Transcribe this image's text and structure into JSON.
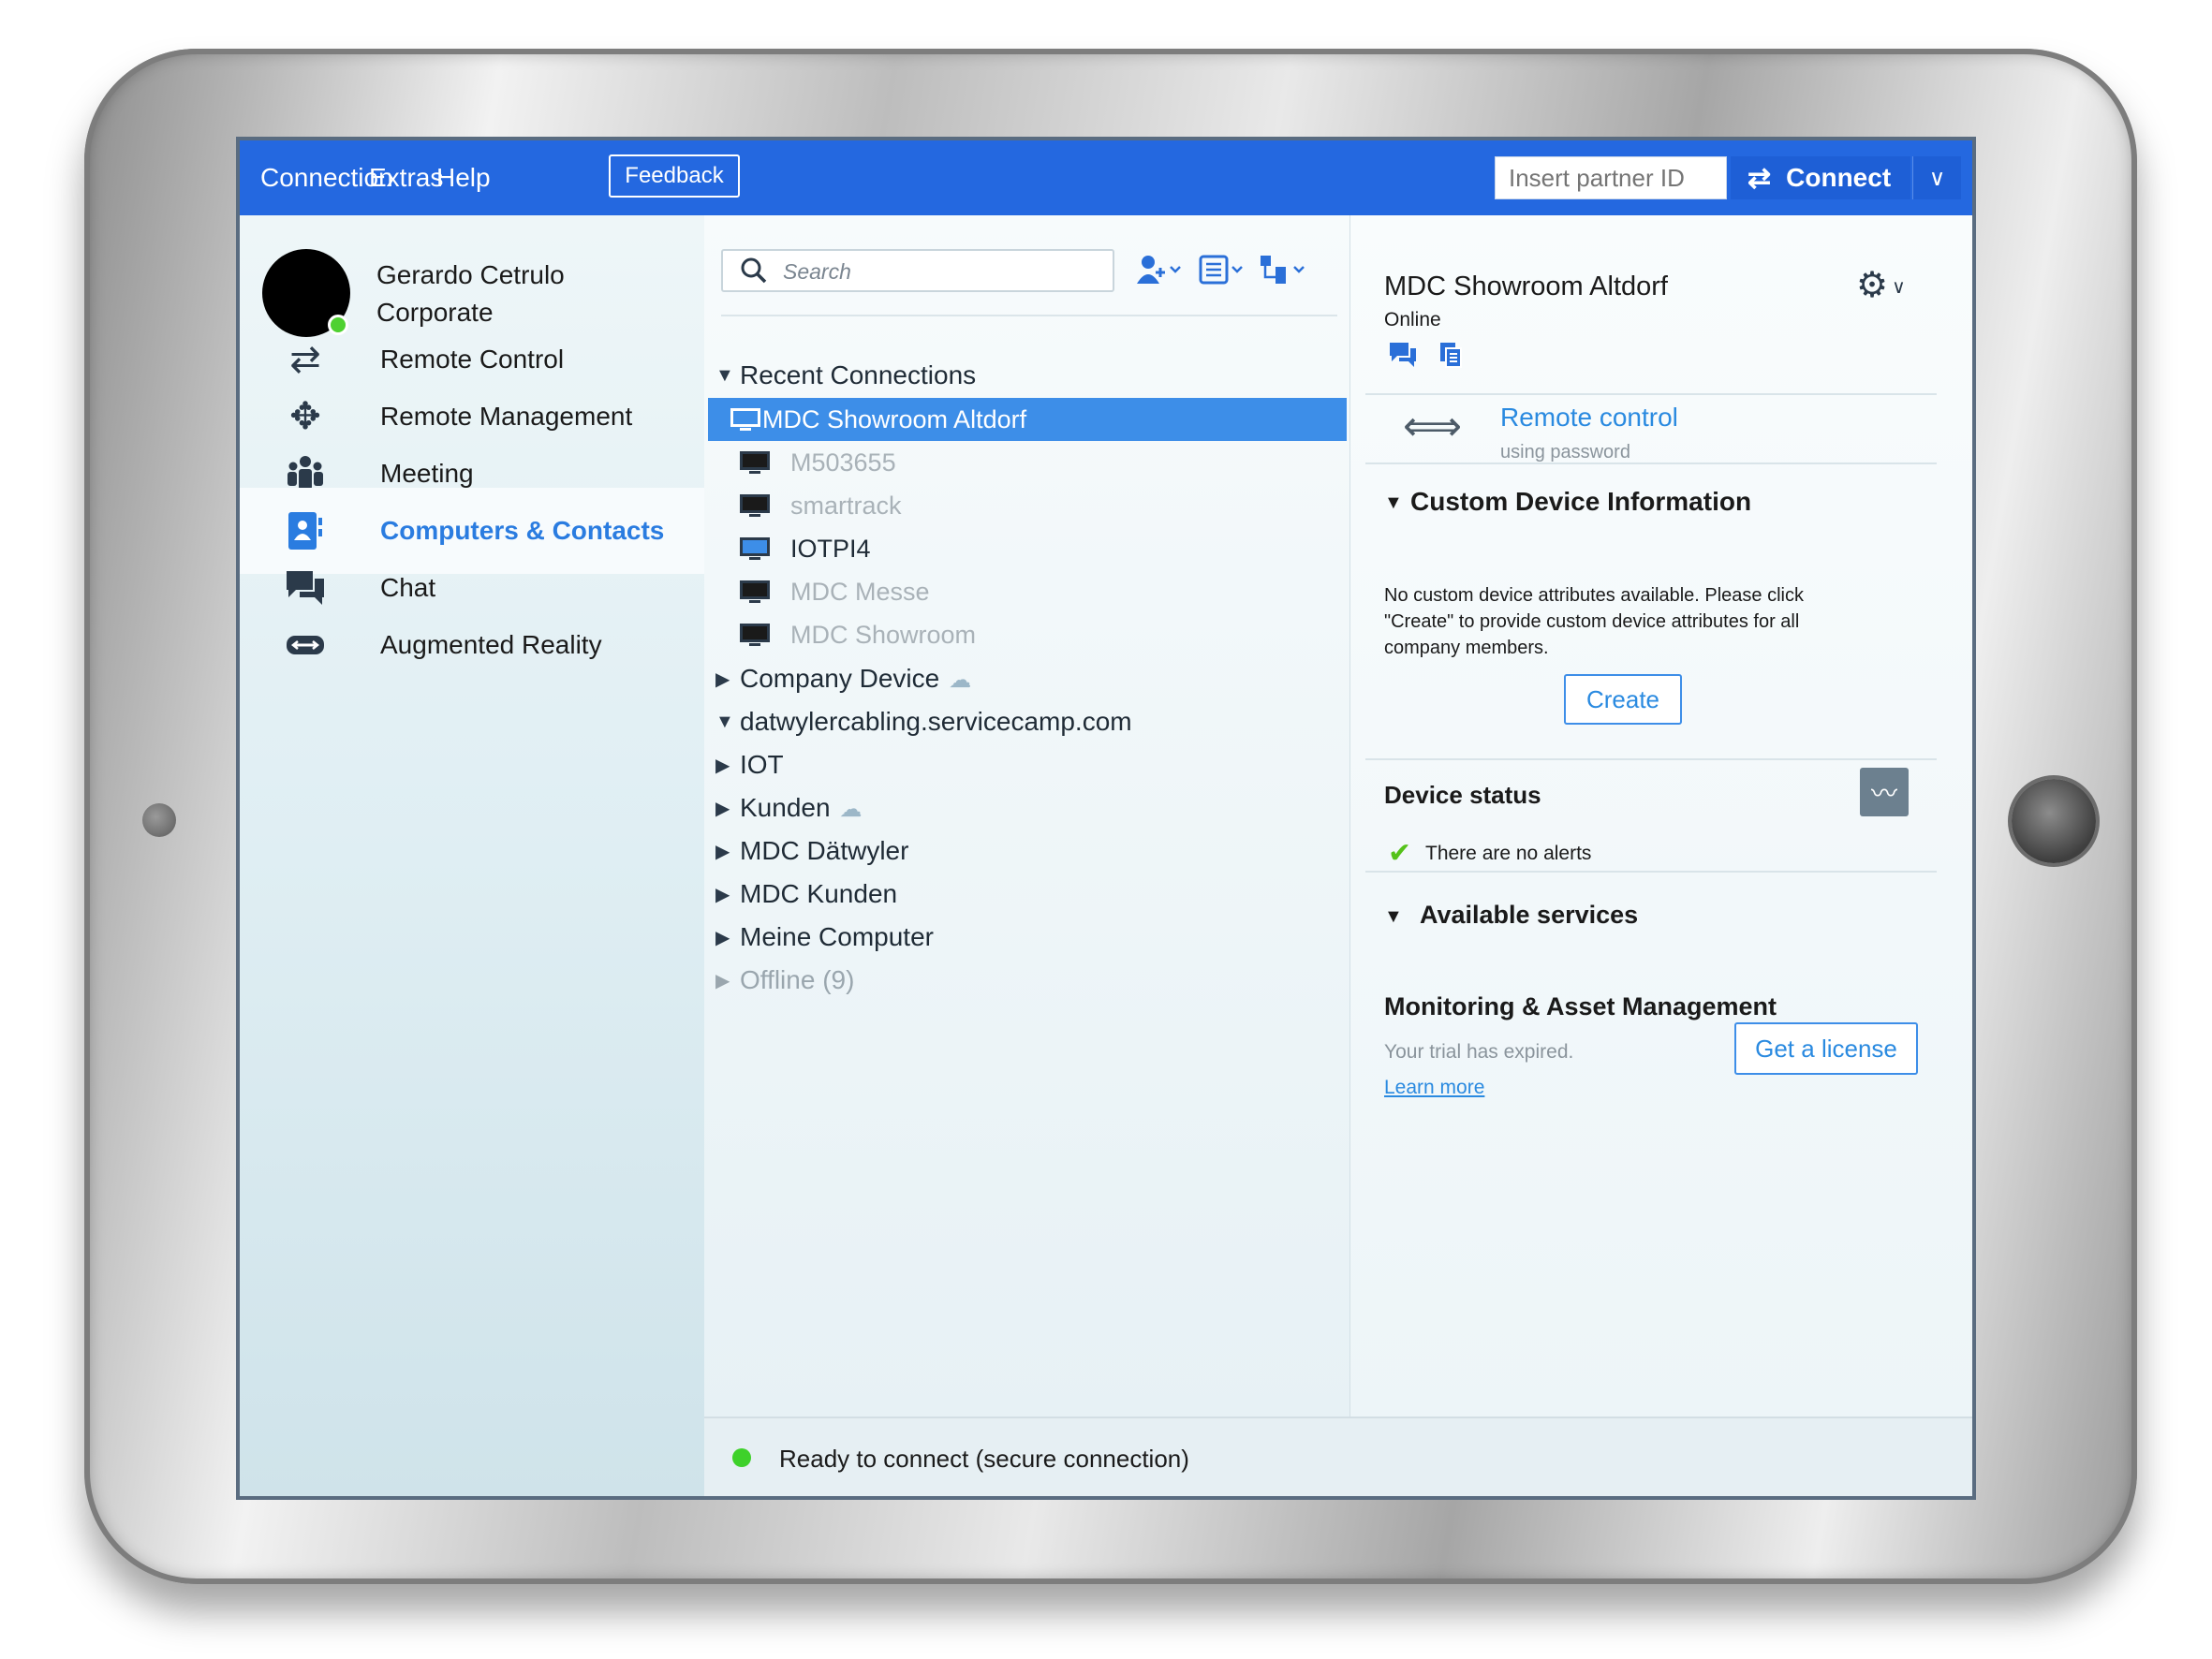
{
  "menu": {
    "connection": "Connection",
    "extras": "Extras",
    "help": "Help",
    "feedback": "Feedback"
  },
  "connect": {
    "placeholder": "Insert partner ID",
    "button_label": "Connect"
  },
  "user": {
    "name": "Gerardo Cetrulo",
    "org": "Corporate",
    "status_color": "#4fd131"
  },
  "nav": {
    "items": [
      {
        "label": "Remote Control",
        "icon": "arrows-icon",
        "active": false
      },
      {
        "label": "Remote Management",
        "icon": "expand-icon",
        "active": false
      },
      {
        "label": "Meeting",
        "icon": "people-icon",
        "active": false
      },
      {
        "label": "Computers & Contacts",
        "icon": "contacts-icon",
        "active": true
      },
      {
        "label": "Chat",
        "icon": "chat-icon",
        "active": false
      },
      {
        "label": "Augmented Reality",
        "icon": "ar-glasses-icon",
        "active": false
      }
    ]
  },
  "search": {
    "placeholder": "Search"
  },
  "tree": {
    "recent_label": "Recent Connections",
    "recent": [
      {
        "name": "MDC Showroom Altdorf",
        "online": true,
        "selected": true
      },
      {
        "name": "M503655",
        "online": false,
        "selected": false
      },
      {
        "name": "smartrack",
        "online": false,
        "selected": false
      },
      {
        "name": "IOTPI4",
        "online": true,
        "selected": false
      },
      {
        "name": "MDC Messe",
        "online": false,
        "selected": false
      },
      {
        "name": "MDC Showroom",
        "online": false,
        "selected": false
      }
    ],
    "groups": [
      {
        "name": "Company Device",
        "cloud": true,
        "expanded": false
      },
      {
        "name": "datwylercabling.servicecamp.com",
        "cloud": false,
        "expanded": true
      },
      {
        "name": "IOT",
        "cloud": false,
        "expanded": false
      },
      {
        "name": "Kunden",
        "cloud": true,
        "expanded": false
      },
      {
        "name": "MDC Dätwyler",
        "cloud": false,
        "expanded": false
      },
      {
        "name": "MDC Kunden",
        "cloud": false,
        "expanded": false
      },
      {
        "name": "Meine Computer",
        "cloud": false,
        "expanded": false
      },
      {
        "name": "Offline (9)",
        "cloud": false,
        "expanded": false
      }
    ]
  },
  "device": {
    "name": "MDC Showroom Altdorf",
    "status": "Online",
    "remote_control": "Remote control",
    "remote_control_sub": "using password",
    "custom_info_title": "Custom Device Information",
    "custom_info_text": "No custom device attributes available. Please click \"Create\" to provide custom device attributes for all company members.",
    "create_label": "Create",
    "status_title": "Device status",
    "alerts_text": "There are no alerts",
    "services_title": "Available services",
    "service_name": "Monitoring & Asset Management",
    "trial_text": "Your trial has expired.",
    "learn_more": "Learn more",
    "license_label": "Get a license"
  },
  "statusbar": {
    "text": "Ready to connect (secure connection)"
  },
  "colors": {
    "accent": "#2468e0",
    "selected": "#3d8ee8",
    "link": "#2a8ae0"
  }
}
